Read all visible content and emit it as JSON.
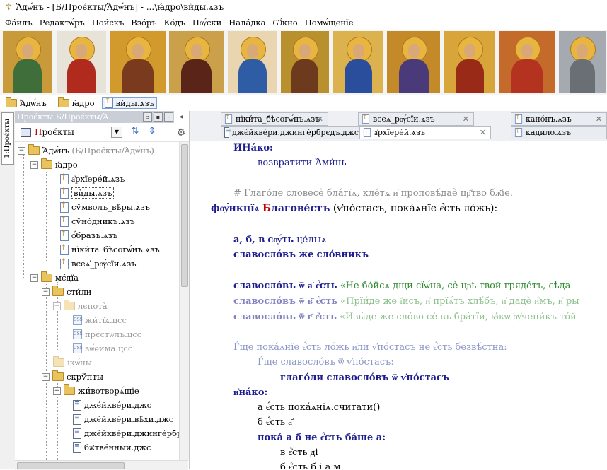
{
  "window": {
    "title": "Ἄдѡ́нъ - [Б/Проє́кты/Ἄдѡ́нъ] - ...\\ꙗ́дро\\вѝды.ѧзъ"
  },
  "menu": [
    "Фа́йлъ",
    "Редактѡ́ръ",
    "Пои́скъ",
    "Взо́ръ",
    "Ко́дъ",
    "Пѹ́ски",
    "Нала́дка",
    "Ѡ́кно",
    "Помѡ́щенїе"
  ],
  "icons": [
    {
      "name": "trinity-icon",
      "bg": "#c89a3a",
      "robe": "#3f6e3a"
    },
    {
      "name": "mandylion-icon",
      "bg": "#e7e3d8",
      "robe": "#b02a1e"
    },
    {
      "name": "pantocrator-icon",
      "bg": "#d29a2c",
      "robe": "#7a3a1d"
    },
    {
      "name": "theotokos-icon",
      "bg": "#caa04a",
      "robe": "#5a2418"
    },
    {
      "name": "madonna-icon",
      "bg": "#e9d6b0",
      "robe": "#2f5da5"
    },
    {
      "name": "christ-icon",
      "bg": "#b8902e",
      "robe": "#6e3a1e"
    },
    {
      "name": "virgin-blue-icon",
      "bg": "#dcb24f",
      "robe": "#2b4e9c"
    },
    {
      "name": "christ-book-icon",
      "bg": "#c48a2a",
      "robe": "#4a3a7a"
    },
    {
      "name": "tenderness-icon",
      "bg": "#d8a53a",
      "robe": "#9a2a18"
    },
    {
      "name": "enthroned-icon",
      "bg": "#c46a2a",
      "robe": "#b33320"
    },
    {
      "name": "silver-icon",
      "bg": "#a5a9b0",
      "robe": "#6a6f76"
    }
  ],
  "breadcrumb": [
    "Ἄдѡ́нъ",
    "ꙗ́дро",
    "вѝды.ѧзъ"
  ],
  "left_strip_tab": "1:Проє́кты",
  "panel": {
    "header": "Проє́кты   Б/Проє́кты/Ἄ...",
    "project_label_red": "П",
    "project_label_rest": "роє́кты"
  },
  "tree": {
    "root": "Ἄдѡ́нъ",
    "root_path": "(Б/Проє́кты/Ἄдѡ́нъ)",
    "core": "ꙗ́дро",
    "core_files": [
      "а҆рхїере́й.ѧзъ",
      "вѝды.ѧзъ",
      "сѷмволъ_вѣ́ры.ѧзъ",
      "сѷно́дникъ.ѧзъ",
      "ѻ҆́бразъ.ѧзъ",
      "нїки́та_бѣсогѡ́нъ.ѧзъ",
      "всеѧ҆_рѹ́сїи.ѧзъ"
    ],
    "media": "мє́дїа",
    "styles": "сти́ли",
    "lepota": "лєпота̀",
    "css_files": [
      "жи́тїѧ.цсс",
      "прє́стѡлъ.цсс",
      "зѡ́ѳима.цсс"
    ],
    "ikony": "ікѡ́ны",
    "scripts": "скрѷ́пты",
    "zhivot": "жи́вотворѧ́щїе",
    "js_files": [
      "джє́йкве́ри.джс",
      "джє́йкве́ри.вѣ́хи.джс",
      "джє́йкве́ри.джинге́рбрєдъ.джс",
      "бж҃тве́нный.джс"
    ]
  },
  "tabs": {
    "row1": [
      "нїки́та_бѣсогѡ́нъ.ѧзъ",
      "всеѧ҆_рѹ́сїи.ѧзъ",
      "кано́нъ.ѧзъ"
    ],
    "row2": [
      "джє́йкве́ри.джинге́рбрєдъ.джс",
      "а҆рхїере́й.ѧзъ",
      "кадило.ѧзъ"
    ]
  },
  "code": {
    "l1_kw": "ИНа́ко:",
    "l2": "возвратити Ἄми́нь",
    "comment": "# Глаго́ле словесѐ бла́гїѧ, кле́тѧ и҆ проповѣ́даѐ цр҃тво бж҃їе.",
    "func_kw": "фѹ́нкцїѧ",
    "func_red": "Б",
    "func_name": "лагове́стъ",
    "func_args": " (ѵ҆по́стасъ, пока́ѧнїе є҆́сть ло́жь):",
    "vars": "а, б, в",
    "vars_kw": "сѹ́ть",
    "vars_val": "це́лыѧ",
    "slav_decl": "славосло́въ",
    "slav_kw": "же",
    "slav_val": "сло́вникъ",
    "s1_pre": "славосло́въ ѿ а҃ є҆́сть",
    "s1_str": "«Не бо́йсѧ дщи сїѡ́на, сѐ цр҃ь твой гряде́тъ, сѣда",
    "s2_pre": "славосло́въ ѿ в҃ є҆́сть",
    "s2_str": "«Прїи́де же і҆исъ, и҆ прїѧ́тъ хлѣ́бъ, и҆ дадѐ и҆́мъ, и҆ ры",
    "s3_pre": "славосло́въ ѿ г҃ є҆́сть",
    "s3_str": "«Изы́де же сло́во сѐ въ бра́тїи, ꙗ҆́кѡ ѹ҆чени́къ то́й",
    "if_dim": "Ѓще пока́ѧнїе є҆́сть ло́жь и҆ли ѵ҆по́стасъ не є҆́сть безвѣ́стна:",
    "if2_dim": "Ѓще славосло́въ ѿ ѵ҆по́стасъ:",
    "call": "глаго́ли славосло́въ ѿ ѵ҆по́стасъ",
    "else_kw": "и҆на́ко:",
    "e1": "а є҆́сть пока́ѧнїѧ.считати()",
    "e2": "б є҆́сть а҃",
    "e3": "пока́ а б не є҆́сть ба́ше а:",
    "e4": "в є҆́сть д҃і",
    "e5": "б є҆́сть б і а м"
  }
}
